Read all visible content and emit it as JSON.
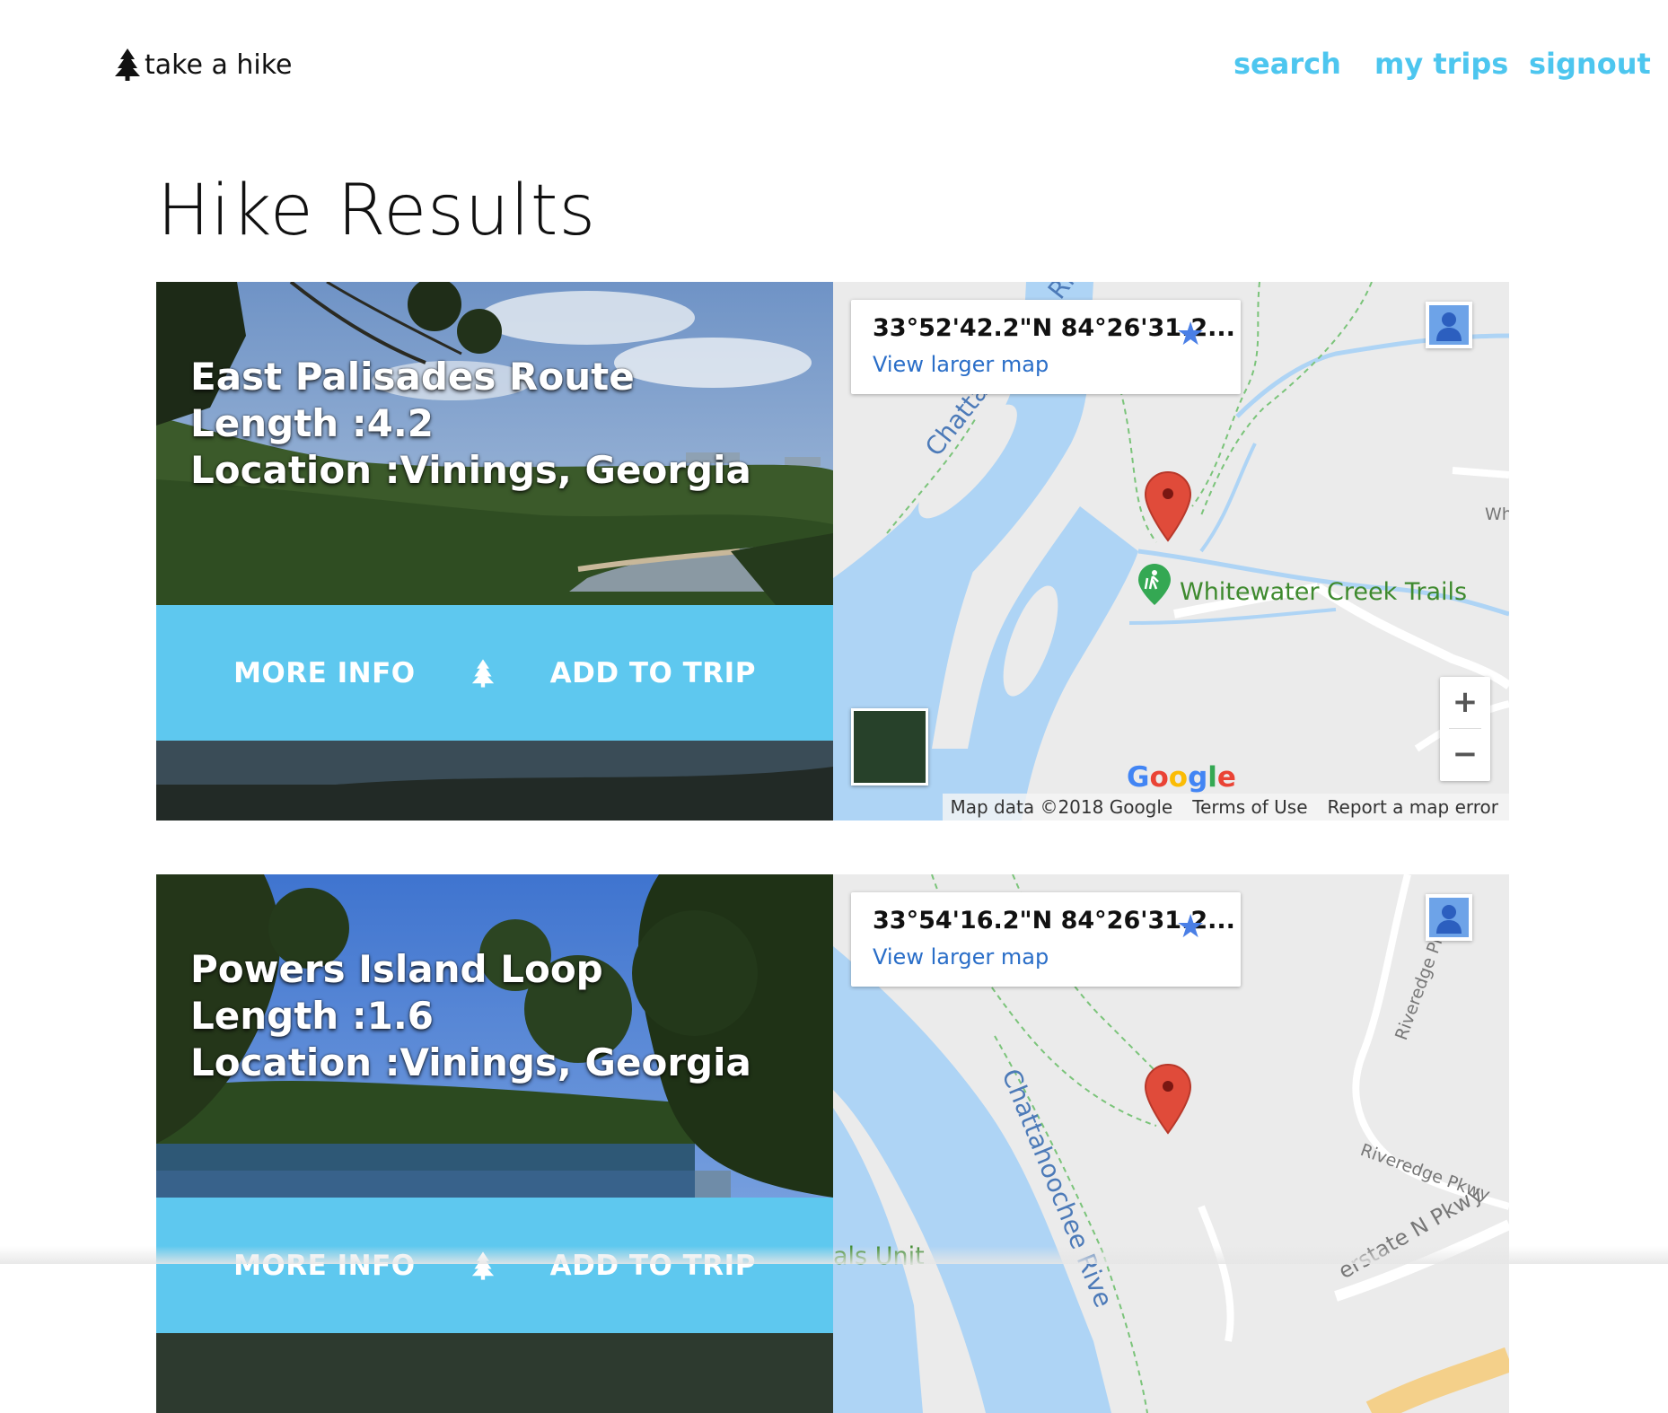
{
  "header": {
    "brand": "take a hike",
    "nav": {
      "search": "search",
      "my_trips": "my trips",
      "signout": "signout"
    }
  },
  "page_title": "Hike Results",
  "colors": {
    "accent": "#5ec8ef",
    "nav_link": "#4dc6ef",
    "map_link": "#2a6ec8",
    "marker": "#e04b3a"
  },
  "icons": [
    "tree-icon",
    "star-icon",
    "person-icon",
    "map-marker-icon",
    "hiker-icon"
  ],
  "results": [
    {
      "name": "East Palisades Route",
      "length": "Length :4.2",
      "location": "Location :Vinings, Georgia",
      "more_info": "MORE INFO",
      "add_to_trip": "ADD TO TRIP",
      "map": {
        "coords": "33°52'42.2\"N 84°26'31.2...",
        "larger_link": "View larger map",
        "river_label": "Chattahoochee River",
        "trail_label": "Whitewater Creek Trails",
        "road_label": "Wh",
        "zoom_in": "+",
        "zoom_out": "−",
        "map_data": "Map data ©2018 Google",
        "terms": "Terms of Use",
        "report": "Report a map error",
        "logo": "Google"
      }
    },
    {
      "name": "Powers Island Loop",
      "length": "Length :1.6",
      "location": "Location :Vinings, Georgia",
      "more_info": "MORE INFO",
      "add_to_trip": "ADD TO TRIP",
      "map": {
        "coords": "33°54'16.2\"N 84°26'31.2...",
        "larger_link": "View larger map",
        "river_label": "Chattahoochee Rive",
        "trail_label": "als Unit",
        "road_label_1": "Riveredge Pkwy",
        "road_label_2": "Riveredge Pkwy",
        "road_label_3": "erstate N Pkwy"
      }
    }
  ]
}
